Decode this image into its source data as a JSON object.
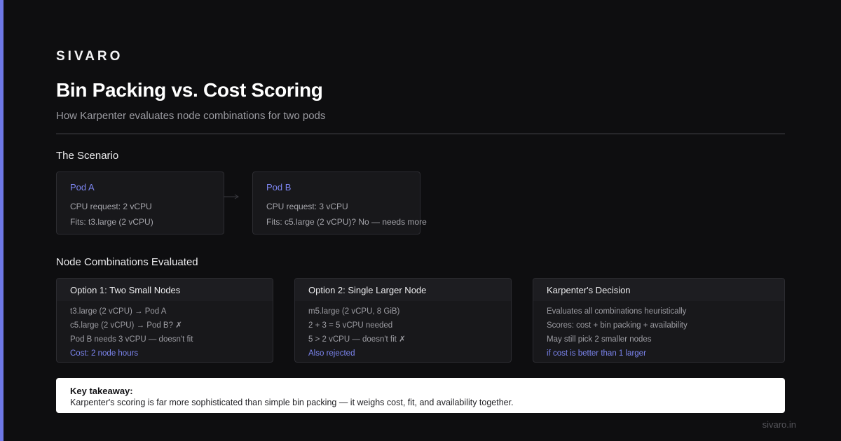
{
  "brand": "SIVARO",
  "title": "Bin Packing vs. Cost Scoring",
  "subtitle": "How Karpenter evaluates node combinations for two pods",
  "scenario": {
    "heading": "The Scenario",
    "pods": [
      {
        "name": "Pod A",
        "lines": [
          "CPU request: 2 vCPU",
          "Fits: t3.large (2 vCPU)"
        ]
      },
      {
        "name": "Pod B",
        "lines": [
          "CPU request: 3 vCPU",
          "Fits: c5.large (2 vCPU)? No — needs more"
        ]
      }
    ]
  },
  "combinations": {
    "heading": "Node Combinations Evaluated",
    "options": [
      {
        "title": "Option 1: Two Small Nodes",
        "lines": [
          "t3.large (2 vCPU) → Pod A",
          "c5.large (2 vCPU) → Pod B? ✗",
          "Pod B needs 3 vCPU — doesn't fit"
        ],
        "highlight": "Cost: 2 node hours"
      },
      {
        "title": "Option 2: Single Larger Node",
        "lines": [
          "m5.large (2 vCPU, 8 GiB)",
          "2 + 3 = 5 vCPU needed",
          "5 > 2 vCPU — doesn't fit ✗"
        ],
        "highlight": "Also rejected"
      },
      {
        "title": "Karpenter's Decision",
        "lines": [
          "Evaluates all combinations heuristically",
          "Scores: cost + bin packing + availability",
          "May still pick 2 smaller nodes"
        ],
        "highlight": "if cost is better than 1 larger"
      }
    ]
  },
  "takeaway": {
    "title": "Key takeaway:",
    "text": "Karpenter's scoring is far more sophisticated than simple bin packing — it weighs cost, fit, and availability together."
  },
  "footer": "sivaro.in",
  "colors": {
    "background": "#0e0e10",
    "accent": "#6e78e6",
    "highlight": "#7c85f0",
    "card": "#18181b"
  }
}
